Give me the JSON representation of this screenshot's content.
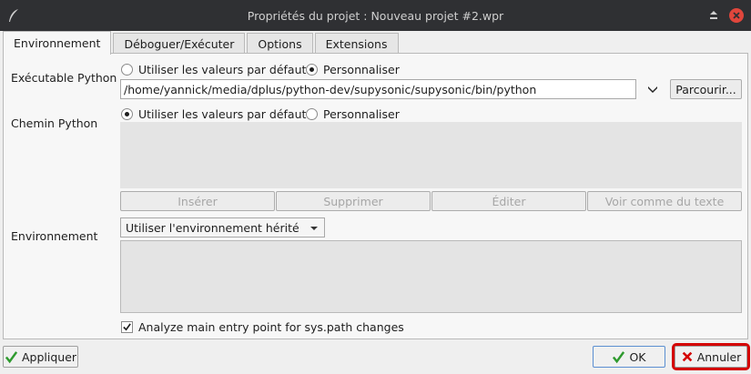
{
  "window": {
    "title": "Propriétés du projet : Nouveau projet #2.wpr"
  },
  "tabs": [
    {
      "label": "Environnement",
      "active": true
    },
    {
      "label": "Déboguer/Exécuter",
      "active": false
    },
    {
      "label": "Options",
      "active": false
    },
    {
      "label": "Extensions",
      "active": false
    }
  ],
  "python_exe": {
    "label": "Exécutable Python",
    "option_default": "Utiliser les valeurs par défaut",
    "option_custom": "Personnaliser",
    "selected": "custom",
    "path_value": "/home/yannick/media/dplus/python-dev/supysonic/supysonic/bin/python",
    "browse_label": "Parcourir..."
  },
  "python_path": {
    "label": "Chemin Python",
    "option_default": "Utiliser les valeurs par défaut",
    "option_custom": "Personnaliser",
    "selected": "default",
    "insert_label": "Insérer",
    "remove_label": "Supprimer",
    "edit_label": "Éditer",
    "view_text_label": "Voir comme du texte"
  },
  "environment": {
    "label": "Environnement",
    "mode_selected": "Utiliser l'environnement hérité"
  },
  "analyze": {
    "label": "Analyze main entry point for sys.path changes",
    "checked": true
  },
  "footer": {
    "apply_label": "Appliquer",
    "ok_label": "OK",
    "cancel_label": "Annuler"
  },
  "colors": {
    "check_green": "#2e9a2e",
    "cancel_red": "#d40000"
  }
}
